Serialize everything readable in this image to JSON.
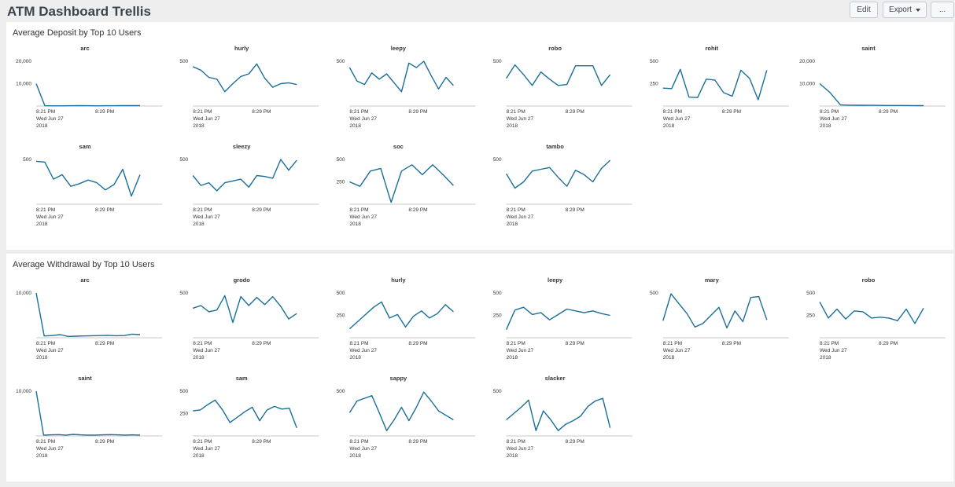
{
  "app": {
    "title": "ATM Dashboard Trellis"
  },
  "toolbar": {
    "edit_label": "Edit",
    "export_label": "Export",
    "more_label": "..."
  },
  "colors": {
    "series": "#1a6f99",
    "panel_bg": "#ffffff",
    "page_bg": "#eeeeee"
  },
  "panels": [
    {
      "title": "Average Deposit by Top 10 Users"
    },
    {
      "title": "Average Withdrawal by Top 10 Users"
    }
  ],
  "chart_data": [
    {
      "type": "line",
      "title": "Average Deposit by Top 10 Users",
      "x_tick_labels": [
        [
          "8:21 PM",
          "Wed Jun 27",
          "2018"
        ],
        [
          "8:29 PM"
        ]
      ],
      "cells": [
        {
          "name": "arc",
          "y_ticks": [
            "20,000",
            "10,000"
          ],
          "values": [
            10000,
            150,
            100,
            120,
            150,
            180,
            150,
            120,
            130,
            150,
            160,
            170,
            180
          ]
        },
        {
          "name": "hurly",
          "y_ticks": [
            "500"
          ],
          "values": [
            440,
            400,
            320,
            300,
            160,
            250,
            330,
            360,
            470,
            310,
            210,
            250,
            260,
            240
          ]
        },
        {
          "name": "leepy",
          "y_ticks": [
            "500"
          ],
          "values": [
            430,
            280,
            240,
            370,
            300,
            360,
            260,
            160,
            480,
            430,
            500,
            340,
            190,
            320,
            230
          ]
        },
        {
          "name": "robo",
          "y_ticks": [
            "500"
          ],
          "values": [
            310,
            460,
            350,
            230,
            380,
            300,
            230,
            240,
            450,
            450,
            450,
            230,
            350
          ]
        },
        {
          "name": "rohit",
          "y_ticks": [
            "500",
            "250"
          ],
          "values": [
            200,
            195,
            410,
            100,
            95,
            300,
            290,
            150,
            110,
            400,
            310,
            70,
            400
          ]
        },
        {
          "name": "saint",
          "y_ticks": [
            "20,000",
            "10,000"
          ],
          "values": [
            10000,
            6000,
            500,
            400,
            350,
            300,
            280,
            250,
            230,
            200,
            190
          ]
        },
        {
          "name": "sam",
          "y_ticks": [
            "500"
          ],
          "values": [
            480,
            470,
            280,
            330,
            200,
            230,
            270,
            240,
            160,
            220,
            390,
            90,
            330
          ]
        },
        {
          "name": "sleezy",
          "y_ticks": [
            "500"
          ],
          "values": [
            320,
            210,
            240,
            150,
            240,
            260,
            280,
            190,
            320,
            310,
            290,
            500,
            380,
            490
          ]
        },
        {
          "name": "soc",
          "y_ticks": [
            "500",
            "250"
          ],
          "values": [
            250,
            200,
            370,
            400,
            20,
            370,
            440,
            330,
            440,
            330,
            210
          ]
        },
        {
          "name": "tambo",
          "y_ticks": [
            "500"
          ],
          "values": [
            340,
            180,
            250,
            370,
            390,
            410,
            300,
            200,
            380,
            330,
            250,
            400,
            490
          ]
        }
      ]
    },
    {
      "type": "line",
      "title": "Average Withdrawal by Top 10 Users",
      "x_tick_labels": [
        [
          "8:21 PM",
          "Wed Jun 27",
          "2018"
        ],
        [
          "8:29 PM"
        ]
      ],
      "cells": [
        {
          "name": "arc",
          "y_ticks": [
            "10,000"
          ],
          "values": [
            10000,
            400,
            500,
            700,
            300,
            350,
            400,
            450,
            500,
            550,
            450,
            500,
            800,
            700
          ]
        },
        {
          "name": "grodo",
          "y_ticks": [
            "500"
          ],
          "values": [
            330,
            360,
            290,
            310,
            470,
            170,
            460,
            360,
            450,
            370,
            460,
            350,
            210,
            270
          ]
        },
        {
          "name": "hurly",
          "y_ticks": [
            "500",
            "250"
          ],
          "values": [
            100,
            180,
            260,
            340,
            400,
            220,
            260,
            120,
            240,
            300,
            220,
            270,
            370,
            290
          ]
        },
        {
          "name": "leepy",
          "y_ticks": [
            "500",
            "250"
          ],
          "values": [
            90,
            310,
            340,
            260,
            280,
            200,
            260,
            320,
            300,
            280,
            300,
            270,
            250
          ]
        },
        {
          "name": "mary",
          "y_ticks": [
            "500"
          ],
          "values": [
            190,
            490,
            380,
            270,
            120,
            160,
            250,
            340,
            110,
            300,
            180,
            450,
            460,
            200
          ]
        },
        {
          "name": "robo",
          "y_ticks": [
            "500",
            "250"
          ],
          "values": [
            400,
            220,
            320,
            210,
            300,
            290,
            220,
            230,
            220,
            190,
            320,
            160,
            330
          ]
        },
        {
          "name": "saint",
          "y_ticks": [
            "10,000"
          ],
          "values": [
            10000,
            200,
            250,
            300,
            200,
            350,
            250,
            200,
            200,
            250,
            300,
            250,
            200,
            250,
            200
          ]
        },
        {
          "name": "sam",
          "y_ticks": [
            "500",
            "250"
          ],
          "values": [
            280,
            290,
            350,
            400,
            290,
            150,
            210,
            270,
            320,
            170,
            290,
            330,
            300,
            310,
            90
          ]
        },
        {
          "name": "sappy",
          "y_ticks": [
            "500"
          ],
          "values": [
            260,
            390,
            420,
            450,
            260,
            60,
            180,
            320,
            170,
            320,
            490,
            390,
            280,
            230,
            180
          ]
        },
        {
          "name": "slacker",
          "y_ticks": [
            "500"
          ],
          "values": [
            180,
            250,
            320,
            400,
            60,
            280,
            180,
            60,
            130,
            170,
            220,
            330,
            390,
            420,
            90
          ]
        }
      ]
    }
  ]
}
